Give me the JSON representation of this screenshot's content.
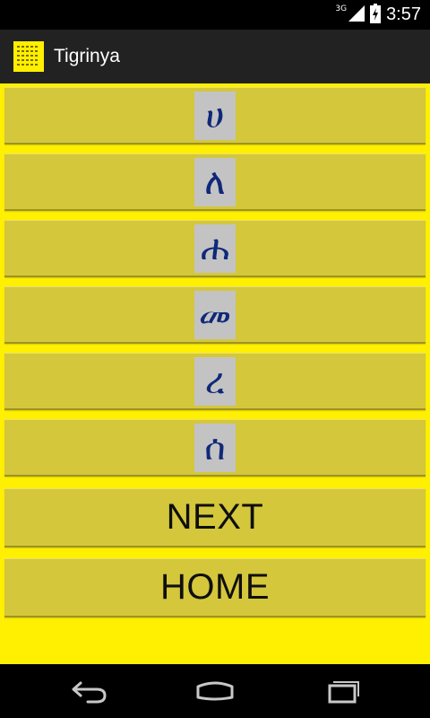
{
  "status_bar": {
    "network_type": "3G",
    "time": "3:57",
    "icons": [
      "signal-icon",
      "battery-charging-icon"
    ]
  },
  "action_bar": {
    "title": "Tigrinya",
    "icon": "app-icon"
  },
  "letters": [
    {
      "glyph": "ሀ"
    },
    {
      "glyph": "ለ"
    },
    {
      "glyph": "ሐ"
    },
    {
      "glyph": "መ"
    },
    {
      "glyph": "ረ"
    },
    {
      "glyph": "ሰ"
    }
  ],
  "buttons": {
    "next_label": "NEXT",
    "home_label": "HOME"
  },
  "colors": {
    "content_background": "#ffef00",
    "button_background": "#d4c73b",
    "glyph_box": "#c3c3c3",
    "glyph_color": "#10287a",
    "action_bar": "#222222"
  },
  "nav_bar": {
    "icons": [
      "back-icon",
      "home-icon",
      "recent-apps-icon"
    ]
  }
}
